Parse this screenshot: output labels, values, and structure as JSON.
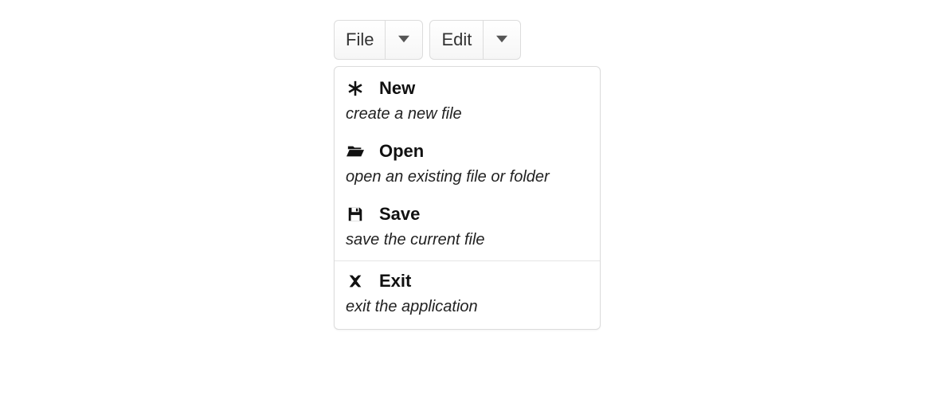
{
  "toolbar": {
    "buttons": [
      {
        "label": "File"
      },
      {
        "label": "Edit"
      }
    ]
  },
  "menu": {
    "items": [
      {
        "icon": "asterisk",
        "label": "New",
        "desc": "create a new file"
      },
      {
        "icon": "folder",
        "label": "Open",
        "desc": "open an existing file or folder"
      },
      {
        "icon": "save",
        "label": "Save",
        "desc": "save the current file"
      },
      {
        "separator": true
      },
      {
        "icon": "close",
        "label": "Exit",
        "desc": "exit the application"
      }
    ]
  }
}
